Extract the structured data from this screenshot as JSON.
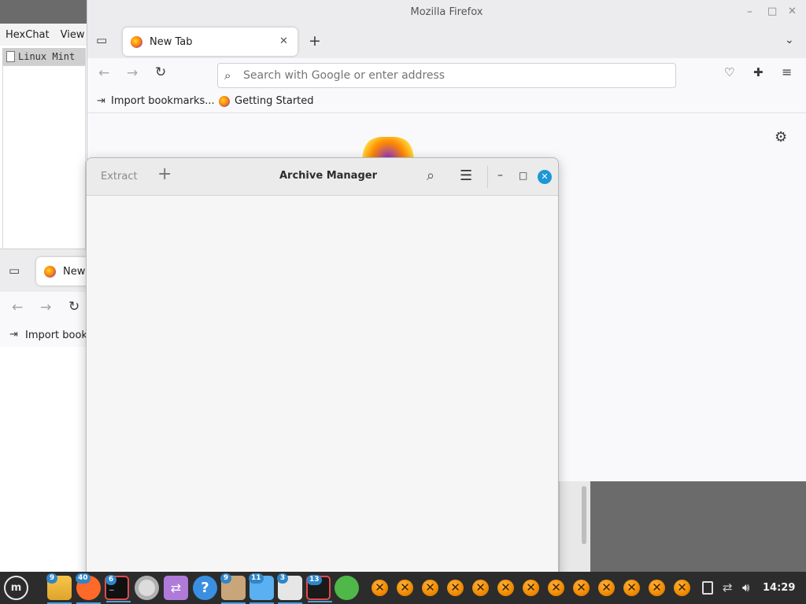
{
  "hexchat": {
    "menu": [
      "HexChat",
      "View"
    ],
    "network_item": "Linux Mint"
  },
  "firefox_main": {
    "window_title": "Mozilla Firefox",
    "tab_label": "New Tab",
    "url_placeholder": "Search with Google or enter address",
    "bookmarks": [
      "Import bookmarks...",
      "Getting Started"
    ]
  },
  "firefox_second": {
    "tab_label": "New",
    "bookmark": "Import book"
  },
  "archive_manager": {
    "title": "Archive Manager",
    "extract_label": "Extract"
  },
  "taskbar": {
    "clock": "14:29",
    "badges": [
      "9",
      "40",
      "6",
      "9",
      "11",
      "3",
      "13"
    ]
  },
  "colors": {
    "accent": "#2f86c9",
    "close_button": "#1c98d6"
  }
}
